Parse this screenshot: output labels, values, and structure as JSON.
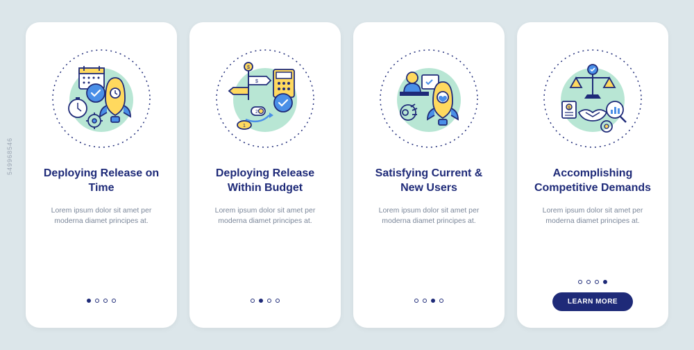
{
  "cards": [
    {
      "title": "Deploying Release on Time",
      "body": "Lorem ipsum dolor sit amet per moderna diamet principes at.",
      "active_dot": 0
    },
    {
      "title": "Deploying Release Within Budget",
      "body": "Lorem ipsum dolor sit amet per moderna diamet principes at.",
      "active_dot": 1
    },
    {
      "title": "Satisfying Current & New Users",
      "body": "Lorem ipsum dolor sit amet per moderna diamet principes at.",
      "active_dot": 2
    },
    {
      "title": "Accomplishing Competitive Demands",
      "body": "Lorem ipsum dolor sit amet per moderna diamet principes at.",
      "active_dot": 3
    }
  ],
  "button_label": "LEARN MORE",
  "watermark": "549968546",
  "colors": {
    "navy": "#1e2a78",
    "blue": "#4a8fe7",
    "yellow": "#ffd95e",
    "mint": "#b8e6d4",
    "grey": "#7a8699"
  }
}
